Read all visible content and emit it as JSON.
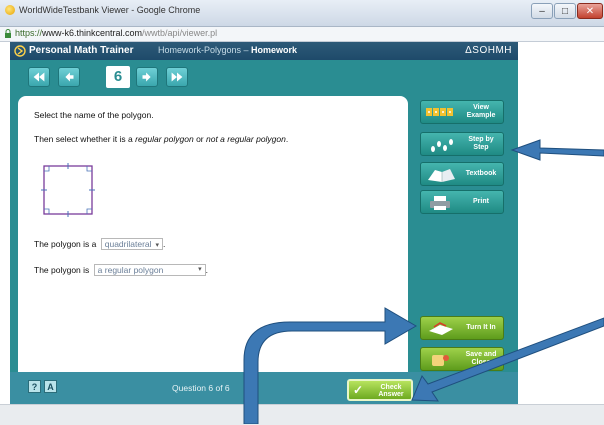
{
  "browser": {
    "window_title": "WorldWideTestbank Viewer - Google Chrome",
    "url_scheme": "https://",
    "url_host": "www-k6.thinkcentral.com",
    "url_path": "/wwtb/api/viewer.pl"
  },
  "app": {
    "title": "Personal Math Trainer",
    "subtitle_prefix": "Homework-Polygons – ",
    "subtitle_bold": "Homework",
    "brand": "ΔSOHMH",
    "question_number": "6",
    "question_count": "Question 6 of 6"
  },
  "question": {
    "line1": "Select the name of the polygon.",
    "line2_a": "Then select whether it is a ",
    "line2_b": "regular polygon",
    "line2_c": " or ",
    "line2_d": "not a regular polygon",
    "line2_e": ".",
    "answer1_prefix": "The polygon is a",
    "answer1_value": "quadrilateral",
    "answer1_suffix": ".",
    "answer2_prefix": "The polygon is",
    "answer2_value": "a regular polygon",
    "answer2_suffix": "."
  },
  "sidebar": {
    "view_example": "View Example",
    "step_by_step": "Step by Step",
    "textbook": "Textbook",
    "print": "Print",
    "turn_it_in": "Turn It In",
    "save_and_close": "Save and Close"
  },
  "footer": {
    "help": "?",
    "tools": "A"
  },
  "check_answer": "Check Answer",
  "colors": {
    "app_teal": "#2a8d92",
    "header_navy": "#1e4a6a",
    "green_button": "#7cb52b",
    "annotation_arrow": "#3c78b4"
  }
}
